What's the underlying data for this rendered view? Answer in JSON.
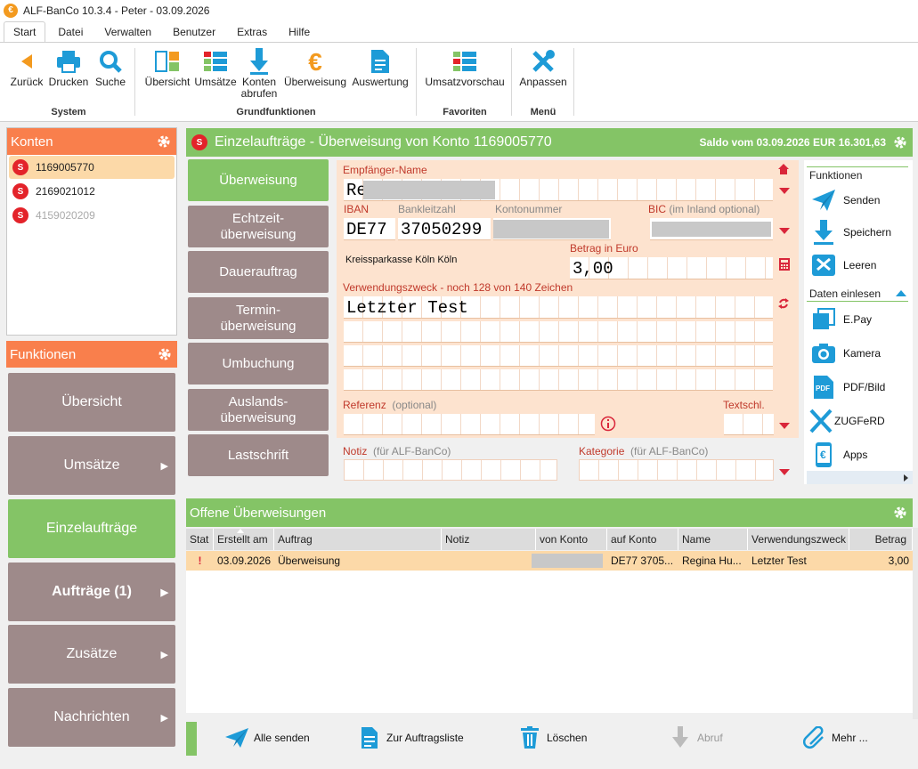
{
  "window": {
    "title": "ALF-BanCo 10.3.4 - Peter  -  03.09.2026"
  },
  "menu_tabs": [
    "Start",
    "Datei",
    "Verwalten",
    "Benutzer",
    "Extras",
    "Hilfe"
  ],
  "ribbon": {
    "buttons": {
      "zurueck": "Zurück",
      "drucken": "Drucken",
      "suche": "Suche",
      "uebersicht": "Übersicht",
      "umsaetze": "Umsätze",
      "konten_abrufen": "Konten abrufen",
      "ueberweisung": "Überweisung",
      "auswertung": "Auswertung",
      "umsatzvorschau": "Umsatzvorschau",
      "anpassen": "Anpassen"
    },
    "groups": {
      "system": "System",
      "grundfunktionen": "Grundfunktionen",
      "favoriten": "Favoriten",
      "menu": "Menü"
    }
  },
  "konten": {
    "title": "Konten",
    "items": [
      {
        "number": "1169005770"
      },
      {
        "number": "2169021012"
      },
      {
        "number": "4159020209"
      }
    ]
  },
  "funktionen": {
    "title": "Funktionen",
    "items": [
      {
        "label": "Übersicht",
        "arrow": ""
      },
      {
        "label": "Umsätze",
        "arrow": "▶"
      },
      {
        "label": "Einzelaufträge",
        "arrow": ""
      },
      {
        "label": "Aufträge (1)",
        "arrow": "▶"
      },
      {
        "label": "Zusätze",
        "arrow": "▶"
      },
      {
        "label": "Nachrichten",
        "arrow": "▶"
      }
    ]
  },
  "main": {
    "title": "Einzelaufträge - Überweisung von Konto 1169005770",
    "saldo": "Saldo vom 03.09.2026 EUR 16.301,63"
  },
  "types": [
    "Überweisung",
    "Echtzeit-überweisung",
    "Dauerauftrag",
    "Termin-überweisung",
    "Umbuchung",
    "Auslands-überweisung",
    "Lastschrift"
  ],
  "form": {
    "empfaenger_label": "Empfänger-Name",
    "empfaenger_value": "Re",
    "iban_label": "IBAN",
    "blz_label": "Bankleitzahl",
    "kontonummer_label": "Kontonummer",
    "bic_label": "BIC",
    "bic_opt": "(im Inland optional)",
    "iban_country": "DE77",
    "blz_value": "37050299",
    "bank_name": "Kreissparkasse Köln Köln",
    "betrag_label": "Betrag in Euro",
    "betrag_value": "3,00",
    "zweck_label": "Verwendungszweck - noch 128 von 140 Zeichen",
    "zweck_value": "Letzter Test",
    "referenz_label": "Referenz",
    "referenz_opt": "(optional)",
    "textschl_label": "Textschl.",
    "notiz_label": "Notiz",
    "notiz_opt": "(für ALF-BanCo)",
    "kategorie_label": "Kategorie",
    "kategorie_opt": "(für ALF-BanCo)"
  },
  "right": {
    "funktionen_title": "Funktionen",
    "senden": "Senden",
    "speichern": "Speichern",
    "leeren": "Leeren",
    "daten_title": "Daten einlesen",
    "epay": "E.Pay",
    "kamera": "Kamera",
    "pdfbild": "PDF/Bild",
    "zugferd": "ZUGFeRD",
    "apps": "Apps"
  },
  "offene": {
    "title": "Offene Überweisungen",
    "columns": [
      "Stat",
      "Erstellt am",
      "Auftrag",
      "Notiz",
      "von Konto",
      "auf Konto",
      "Name",
      "Verwendungszweck",
      "Betrag"
    ],
    "rows": [
      {
        "stat": "!",
        "erstellt": "03.09.2026",
        "auftrag": "Überweisung",
        "notiz": "",
        "auf_konto": "DE77 3705...",
        "name": "Regina Hu...",
        "zweck": "Letzter Test",
        "betrag": "3,00"
      }
    ]
  },
  "bottom": {
    "alle_senden": "Alle senden",
    "zur_auftragsliste": "Zur Auftragsliste",
    "loeschen": "Löschen",
    "abruf": "Abruf",
    "mehr": "Mehr ..."
  },
  "colors": {
    "accent_green": "#84c466",
    "accent_orange": "#f97f4c",
    "button_brown": "#9e8a8a",
    "form_bg": "#fde3cf",
    "label_red": "#c0392b",
    "icon_blue": "#1e9bd7"
  }
}
